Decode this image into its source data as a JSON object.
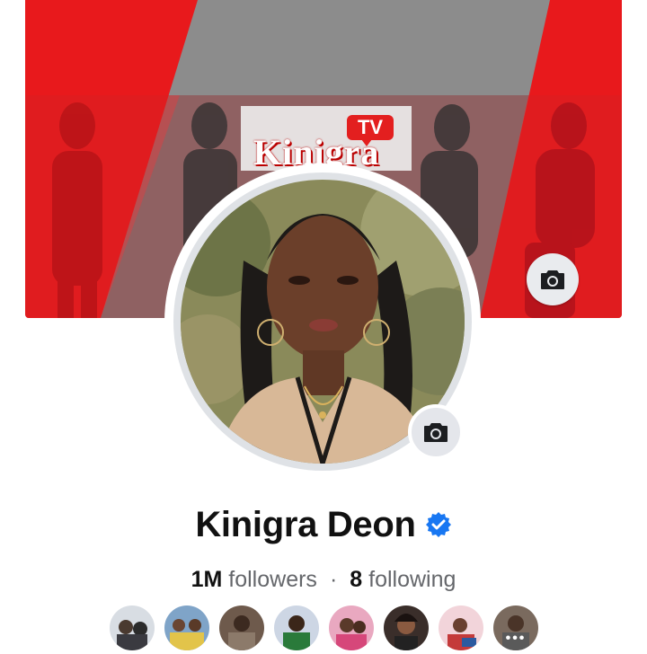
{
  "profile": {
    "name": "Kinigra Deon",
    "verified": true,
    "followers_count": "1M",
    "followers_label": "followers",
    "separator": "·",
    "following_count": "8",
    "following_label": "following"
  },
  "cover": {
    "brand_word": "Kinigra",
    "brand_badge": "TV",
    "camera_icon": "camera-icon"
  },
  "avatar": {
    "camera_icon": "camera-icon"
  },
  "followers_preview": {
    "count_shown": 8,
    "overflow_indicator": "•••"
  },
  "colors": {
    "brand_red": "#e31f1f",
    "verified_blue": "#1877f2",
    "muted_text": "#65676b"
  }
}
